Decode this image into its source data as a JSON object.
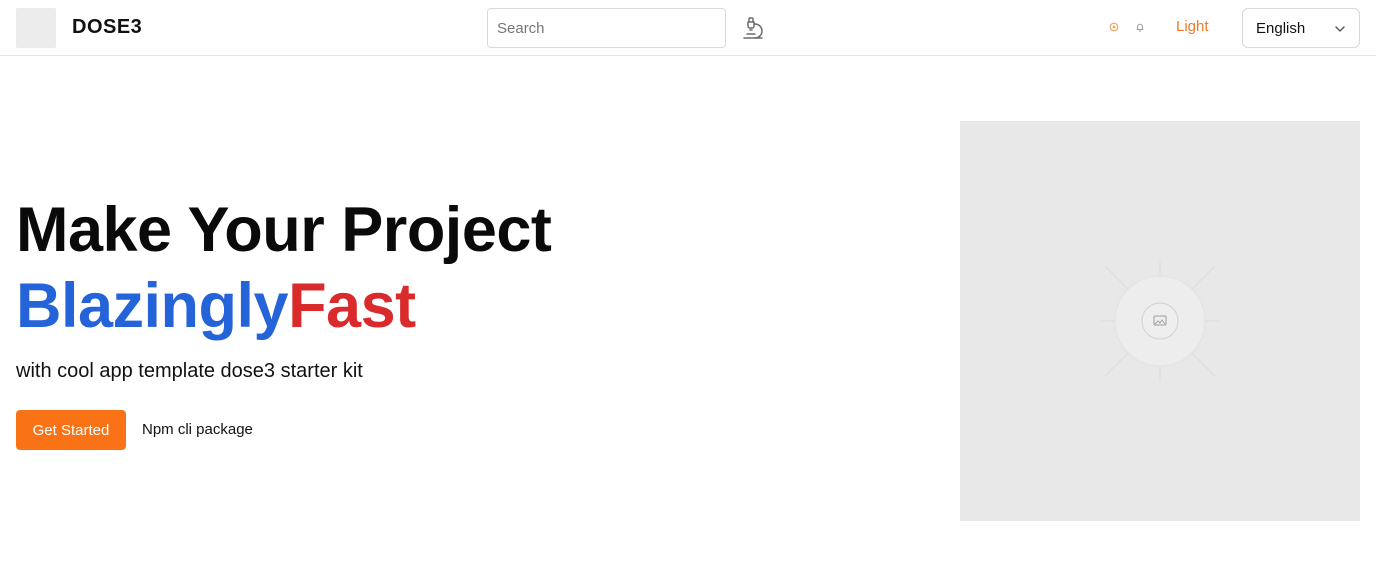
{
  "header": {
    "brand": "DOSE3",
    "search": {
      "placeholder": "Search",
      "value": ""
    },
    "icons": [
      "microscope-icon",
      "sun-icon",
      "bell-icon",
      "chevron-down-icon"
    ],
    "theme_label": "Light",
    "language": {
      "selected": "English"
    }
  },
  "hero": {
    "title_line1": "Make Your Project",
    "title_word_blue": "Blazingly",
    "title_word_red": "Fast",
    "subtitle": "with cool app template dose3 starter kit",
    "primary_button": "Get Started",
    "secondary_link": "Npm cli package"
  },
  "colors": {
    "accent": "#f97316",
    "title_blue": "#2563d9",
    "title_red": "#d92b2b",
    "placeholder_bg": "#e8e8e8"
  }
}
